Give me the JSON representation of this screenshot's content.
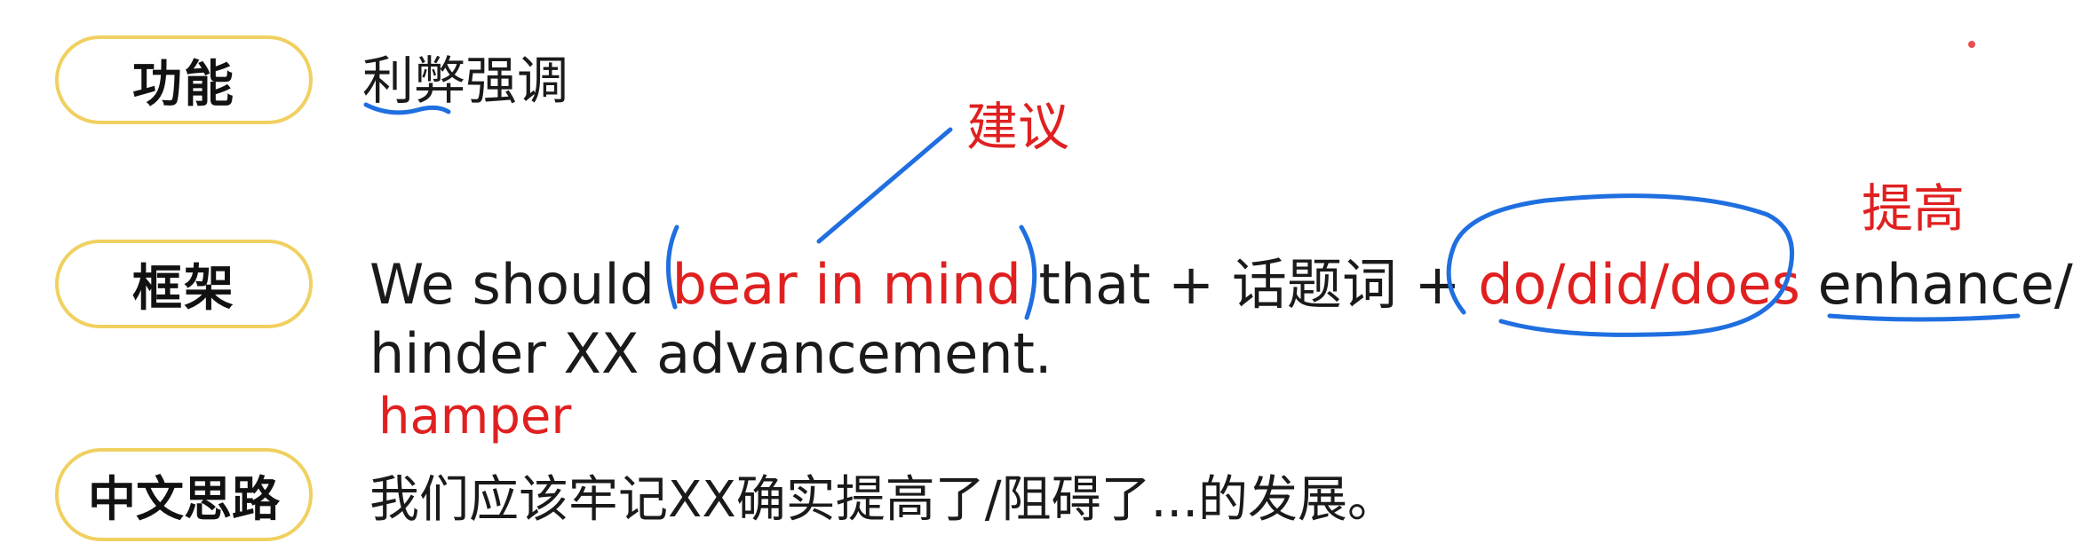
{
  "rows": {
    "function": {
      "label": "功能",
      "text": "利弊强调"
    },
    "framework": {
      "label": "框架",
      "line1": {
        "pre": "We should ",
        "red1": "bear in mind",
        "mid": " that + 话题词 + ",
        "red2": "do/did/does",
        "post": " enhance/"
      },
      "line2": "hinder XX advancement."
    },
    "chinese": {
      "label": "中文思路",
      "text": "我们应该牢记XX确实提高了/阻碍了...的发展。"
    }
  },
  "annotations": {
    "jianyi": "建议",
    "tigao": "提高",
    "hamper": "hamper"
  },
  "colors": {
    "pill_border": "#f0d060",
    "annotation_red": "#e02020",
    "ink_blue": "#1f6fe0"
  }
}
